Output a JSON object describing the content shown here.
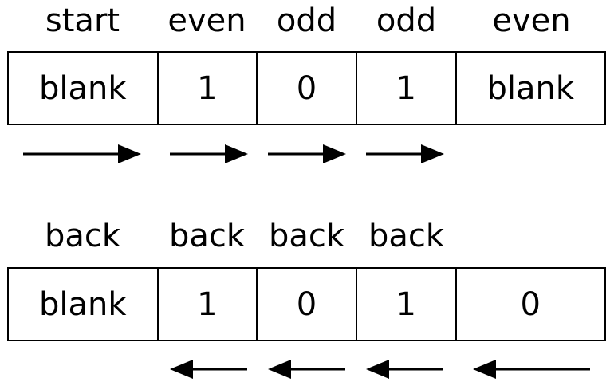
{
  "top": {
    "labels": [
      "start",
      "even",
      "odd",
      "odd",
      "even"
    ],
    "cells": [
      "blank",
      "1",
      "0",
      "1",
      "blank"
    ]
  },
  "bottom": {
    "labels": [
      "back",
      "back",
      "back",
      "back"
    ],
    "cells": [
      "blank",
      "1",
      "0",
      "1",
      "0"
    ]
  },
  "colors": {
    "stroke": "#000000",
    "background": "#ffffff"
  }
}
